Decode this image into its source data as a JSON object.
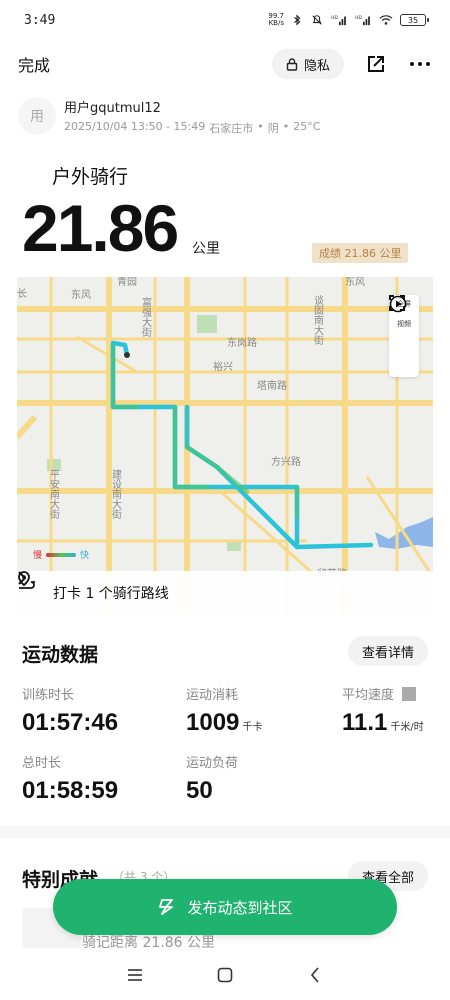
{
  "status_bar": {
    "time": "3:49",
    "net_speed_value": "99.7",
    "net_speed_unit": "KB/s",
    "battery": "35"
  },
  "nav": {
    "done_label": "完成",
    "privacy_label": "隐私"
  },
  "user": {
    "avatar_text": "用",
    "name": "用户gqutmul12",
    "time_range": "2025/10/04 13:50 - 15:49",
    "city": "石家庄市",
    "weather": "阴",
    "temperature": "25°C",
    "separator": "•"
  },
  "activity": {
    "type": "户外骑行",
    "distance": "21.86",
    "unit": "公里",
    "score_badge": "成绩 21.86 公里"
  },
  "map": {
    "fullscreen_label": "全屏",
    "video_label": "视频",
    "legend_slow": "慢",
    "legend_fast": "快",
    "checkin_text": "打卡 1 个骑行路线",
    "labels": {
      "dongfeng": "东风",
      "qingyuan": "青园",
      "dongfeng2": "东风",
      "fuqiang": "富强大街",
      "tanhe": "谈固南大街",
      "donggang": "东岗路",
      "yuxing": "裕兴",
      "tanan": "塔南路",
      "fangxing": "方兴路",
      "pingan": "平安南大街",
      "jianshe": "建设南大街",
      "fanyuan": "留营路",
      "left_edge": "长"
    },
    "colors": {
      "route_cyan": "#2bc3dc",
      "route_green": "#4cc46a",
      "road_yellow": "#f7d98a",
      "water": "#8fb6e8",
      "green_area": "#bfe0b6"
    }
  },
  "stats": {
    "title": "运动数据",
    "detail_button": "查看详情",
    "items": [
      {
        "label": "训练时长",
        "value": "01:57:46",
        "unit": ""
      },
      {
        "label": "运动消耗",
        "value": "1009",
        "unit": "千卡"
      },
      {
        "label": "平均速度",
        "value": "11.1",
        "unit": "千米/时"
      },
      {
        "label": "总时长",
        "value": "01:58:59",
        "unit": ""
      },
      {
        "label": "运动负荷",
        "value": "50",
        "unit": ""
      }
    ]
  },
  "achievements": {
    "title": "特别成就",
    "count": "（共 3 个）",
    "view_all": "查看全部",
    "item_text": "骑记距离 21.86 公里"
  },
  "publish": {
    "label": "发布动态到社区"
  }
}
